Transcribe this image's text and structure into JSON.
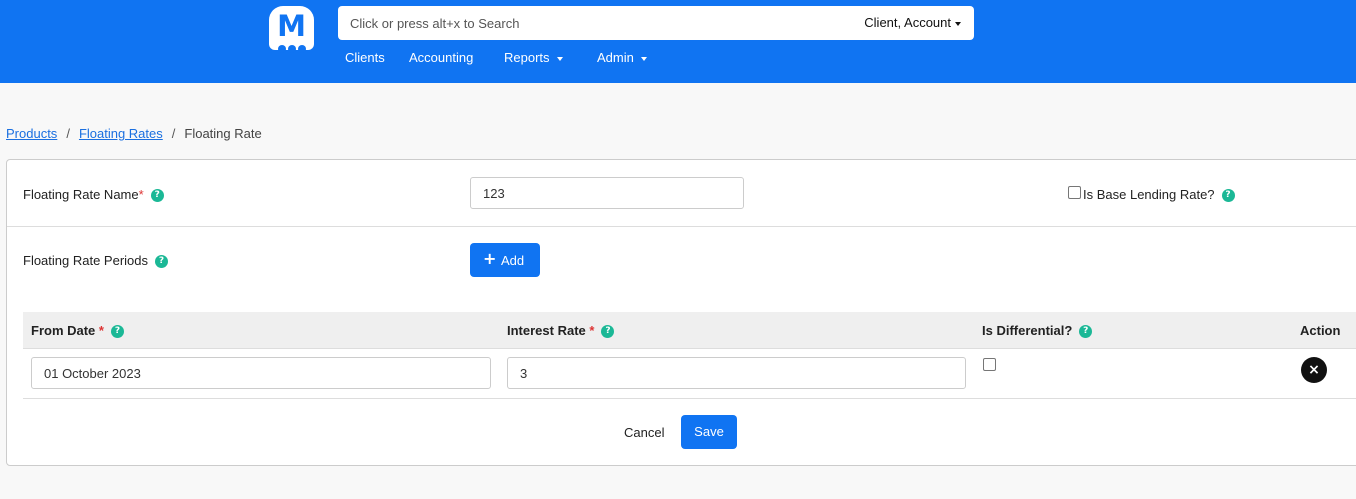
{
  "header": {
    "logo_letter": "M",
    "search_placeholder": "Click or press alt+x to Search",
    "search_scope": "Client, Account",
    "nav": [
      "Clients",
      "Accounting",
      "Reports",
      "Admin"
    ]
  },
  "breadcrumb": {
    "items": [
      "Products",
      "Floating Rates"
    ],
    "current": "Floating Rate"
  },
  "form": {
    "name_label": "Floating Rate Name",
    "name_value": "123",
    "base_lending_label": "Is Base Lending Rate?",
    "periods_label": "Floating Rate Periods",
    "add_label": "Add",
    "table": {
      "headers": {
        "from_date": "From Date",
        "interest_rate": "Interest Rate",
        "is_differential": "Is Differential?",
        "action": "Action"
      },
      "rows": [
        {
          "from_date": "01 October 2023",
          "interest_rate": "3",
          "is_differential": false
        }
      ]
    },
    "cancel_label": "Cancel",
    "save_label": "Save"
  },
  "colors": {
    "primary": "#1074f2",
    "help": "#1bb896",
    "required": "#dd3333"
  }
}
